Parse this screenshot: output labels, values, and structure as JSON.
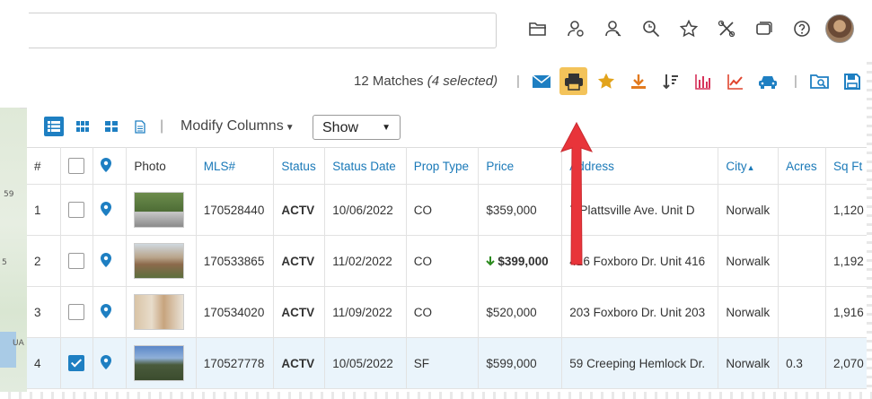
{
  "toolbar": {
    "matches_count": "12 Matches",
    "matches_selected": "(4 selected)",
    "sep1": "|",
    "sep2": "|"
  },
  "viewbar": {
    "modify_columns": "Modify Columns",
    "show_label": "Show",
    "sep": "|"
  },
  "colors": {
    "accent_blue": "#1e7fc2",
    "active_green": "#2b8a1e",
    "print_highlight": "#f3c35a",
    "arrow_red": "#e8343a"
  },
  "top_icons": [
    "folder-icon",
    "user-switch-icon",
    "user-remove-icon",
    "search-zoom-icon",
    "star-outline-icon",
    "tools-icon",
    "cards-icon",
    "help-icon"
  ],
  "toolbar_icons": [
    "email-icon",
    "print-icon",
    "favorite-star-icon",
    "download-icon",
    "sort-icon",
    "bar-chart-icon",
    "line-chart-icon",
    "car-icon",
    "folder-search-icon",
    "save-icon"
  ],
  "table": {
    "headers": {
      "num": "#",
      "pin": "",
      "photo": "Photo",
      "mls": "MLS#",
      "status": "Status",
      "status_date": "Status Date",
      "prop_type": "Prop Type",
      "price": "Price",
      "address": "Address",
      "city": "City",
      "acres": "Acres",
      "sqft": "Sq Ft"
    },
    "rows": [
      {
        "num": "1",
        "checked": false,
        "mls": "170528440",
        "status": "ACTV",
        "status_date": "10/06/2022",
        "prop_type": "CO",
        "price": "$359,000",
        "price_down": false,
        "address": "7 Plattsville Ave. Unit D",
        "city": "Norwalk",
        "acres": "",
        "sqft": "1,120"
      },
      {
        "num": "2",
        "checked": false,
        "mls": "170533865",
        "status": "ACTV",
        "status_date": "11/02/2022",
        "prop_type": "CO",
        "price": "$399,000",
        "price_down": true,
        "address": "416 Foxboro Dr. Unit 416",
        "city": "Norwalk",
        "acres": "",
        "sqft": "1,192"
      },
      {
        "num": "3",
        "checked": false,
        "mls": "170534020",
        "status": "ACTV",
        "status_date": "11/09/2022",
        "prop_type": "CO",
        "price": "$520,000",
        "price_down": false,
        "address": "203 Foxboro Dr. Unit 203",
        "city": "Norwalk",
        "acres": "",
        "sqft": "1,916"
      },
      {
        "num": "4",
        "checked": true,
        "mls": "170527778",
        "status": "ACTV",
        "status_date": "10/05/2022",
        "prop_type": "SF",
        "price": "$599,000",
        "price_down": false,
        "address": "59 Creeping Hemlock Dr.",
        "city": "Norwalk",
        "acres": "0.3",
        "sqft": "2,070"
      }
    ]
  },
  "map_labels": [
    "59",
    "5",
    "UA"
  ]
}
